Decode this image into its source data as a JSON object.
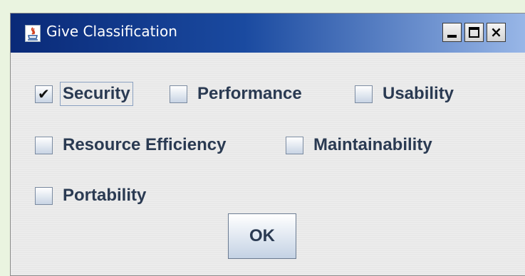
{
  "window": {
    "title": "Give Classification",
    "icon": "java-icon",
    "controls": {
      "minimize": "minimize-icon",
      "maximize": "maximize-icon",
      "close_label": "×"
    }
  },
  "checkboxes": [
    {
      "label": "Security",
      "checked": true
    },
    {
      "label": "Performance",
      "checked": false
    },
    {
      "label": "Usability",
      "checked": false
    },
    {
      "label": "Resource Efficiency",
      "checked": false
    },
    {
      "label": "Maintainability",
      "checked": false
    },
    {
      "label": "Portability",
      "checked": false
    }
  ],
  "check_glyph": "✔",
  "ok_label": "OK",
  "colors": {
    "titlebar_start": "#0a2a78",
    "titlebar_end": "#9ab8e8",
    "label_text": "#2a3a52",
    "background": "#e8e8e8"
  }
}
